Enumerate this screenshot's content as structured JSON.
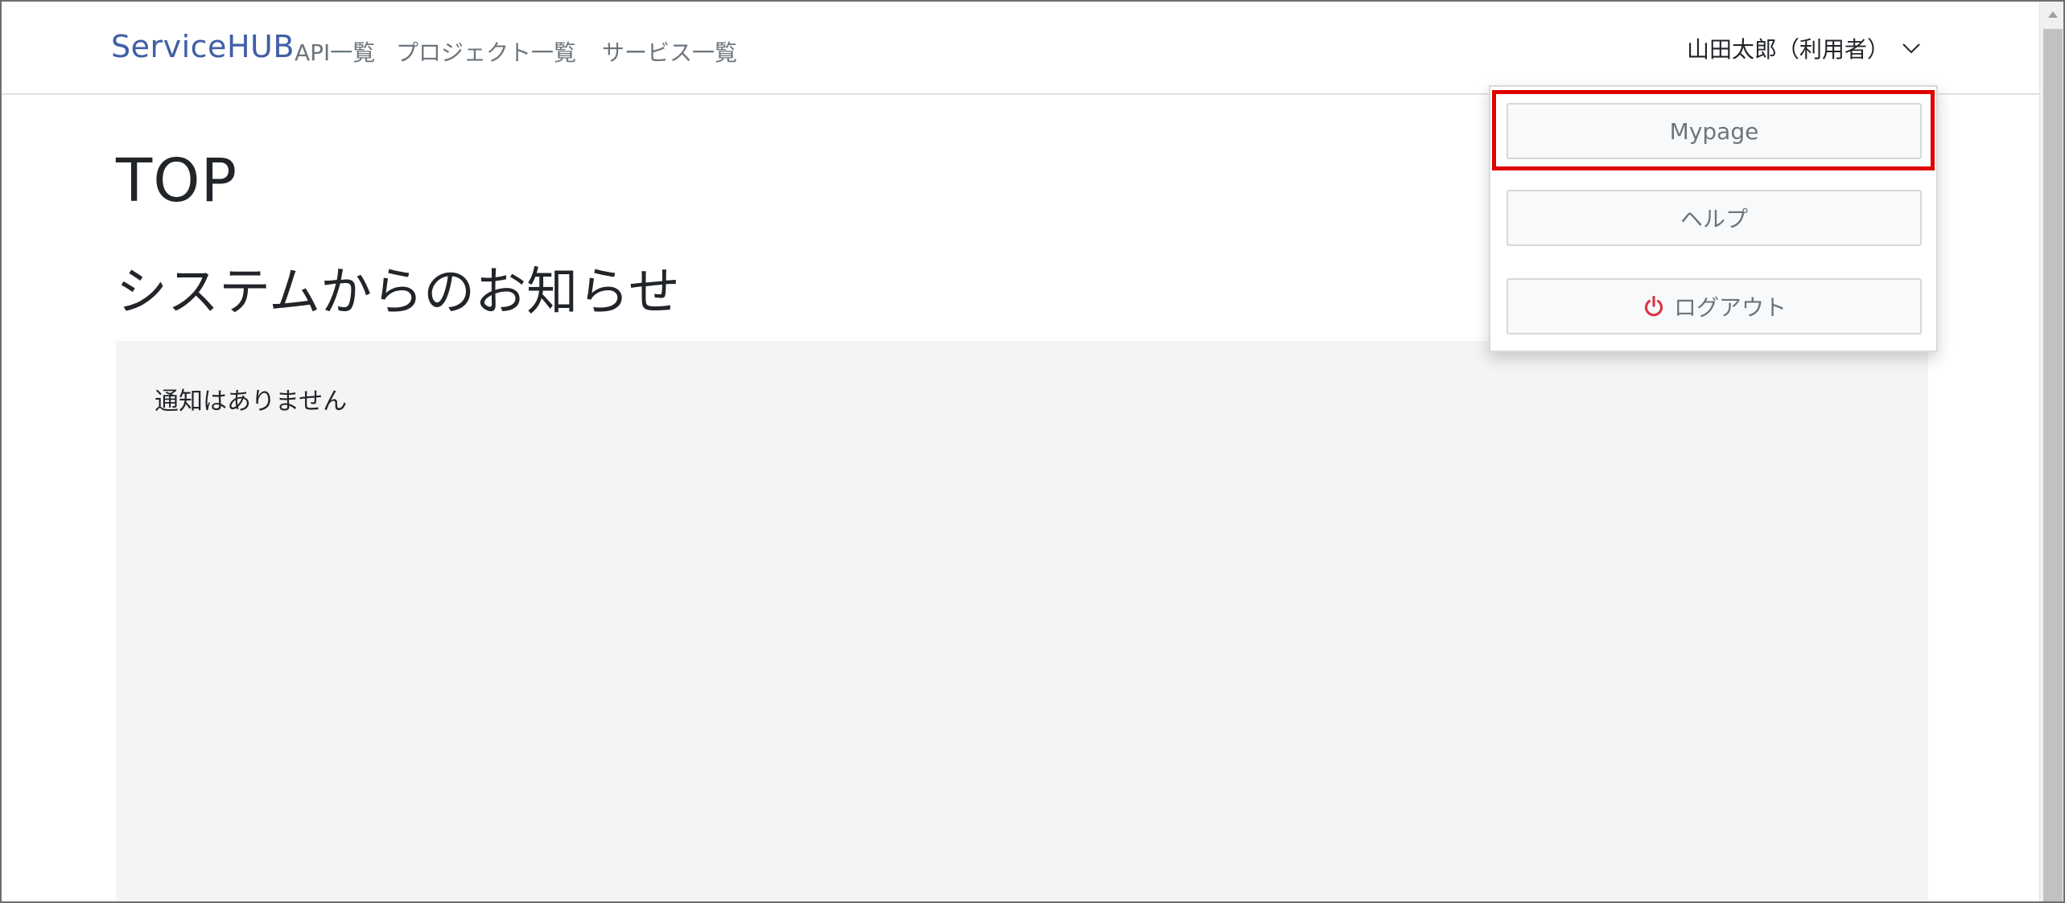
{
  "navbar": {
    "brand": "ServiceHUB",
    "links": [
      "API一覧",
      "プロジェクト一覧",
      "サービス一覧"
    ],
    "user_label": "山田太郎（利用者）"
  },
  "dropdown": {
    "items": [
      {
        "label": "Mypage",
        "icon": null
      },
      {
        "label": "ヘルプ",
        "icon": null
      },
      {
        "label": "ログアウト",
        "icon": "power-icon"
      }
    ],
    "highlighted_item": "Mypage",
    "colors": {
      "highlight": "#e00000",
      "logout_icon": "#dc3545"
    }
  },
  "main": {
    "title": "TOP",
    "section_title": "システムからのお知らせ",
    "notice_text": "通知はありません"
  },
  "colors": {
    "brand": "#3f5fa6",
    "notice_bg": "#f4f4f4"
  }
}
